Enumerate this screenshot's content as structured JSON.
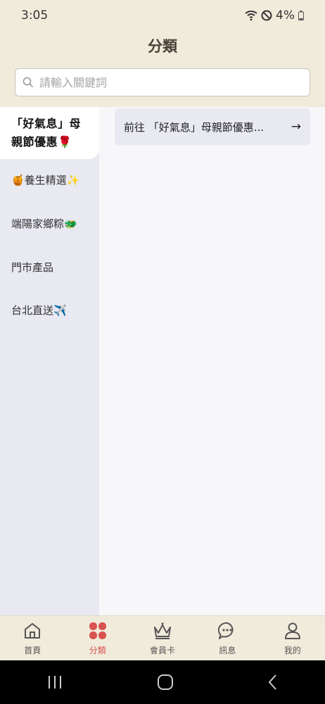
{
  "status_bar": {
    "time": "3:05",
    "battery": "4%"
  },
  "header": {
    "title": "分類"
  },
  "search": {
    "placeholder": "請輸入關鍵詞"
  },
  "sidebar": {
    "active_label": "「好氣息」母親節優惠🌹",
    "items": [
      {
        "label": "🍯養生精選✨"
      },
      {
        "label": "端陽家鄉粽🐲"
      },
      {
        "label": "門市產品"
      },
      {
        "label": "台北直送✈️"
      }
    ]
  },
  "content": {
    "goto_text": "前往 「好氣息」母親節優惠...",
    "goto_arrow": "→"
  },
  "tabbar": {
    "tabs": [
      {
        "label": "首頁"
      },
      {
        "label": "分類"
      },
      {
        "label": "會員卡"
      },
      {
        "label": "訊息"
      },
      {
        "label": "我的"
      }
    ]
  },
  "colors": {
    "accent": "#d9534f",
    "header_bg": "#f1ebdc",
    "sidebar_bg": "#e8e9f1"
  }
}
